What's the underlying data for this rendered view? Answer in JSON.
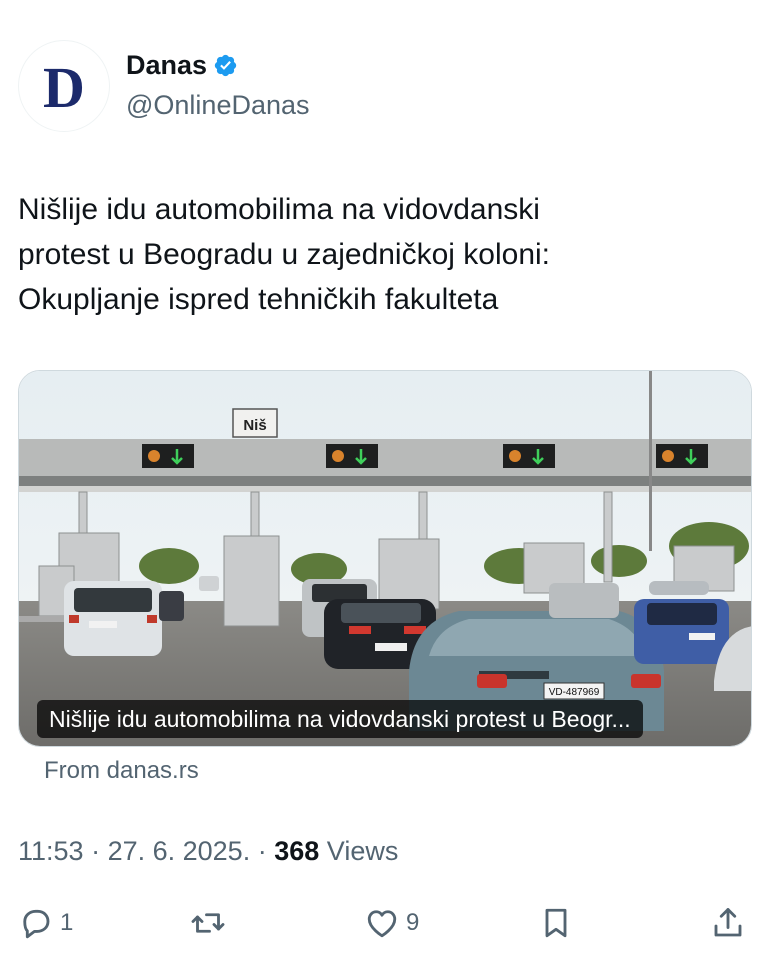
{
  "author": {
    "avatar_letter": "D",
    "display_name": "Danas",
    "handle": "@OnlineDanas",
    "verified_color": "#1d9bf0"
  },
  "tweet": {
    "lines": [
      "Nišlije idu automobilima na vidovdanski",
      "protest u Beogradu u zajedničkoj koloni:",
      "Okupljanje ispred tehničkih fakulteta"
    ]
  },
  "card": {
    "sign_text": "Niš",
    "caption": "Nišlije idu automobilima na vidovdanski protest u Beogr...",
    "source": "From danas.rs",
    "plates": [
      "VD-487969"
    ]
  },
  "meta": {
    "time": "11:53",
    "date": "27. 6. 2025.",
    "views_count": "368",
    "views_label": "Views"
  },
  "actions": {
    "reply_count": "1",
    "repost_count": "",
    "like_count": "9"
  },
  "colors": {
    "text_primary": "#0f1419",
    "text_secondary": "#536471",
    "brand_navy": "#1c2a6b"
  }
}
